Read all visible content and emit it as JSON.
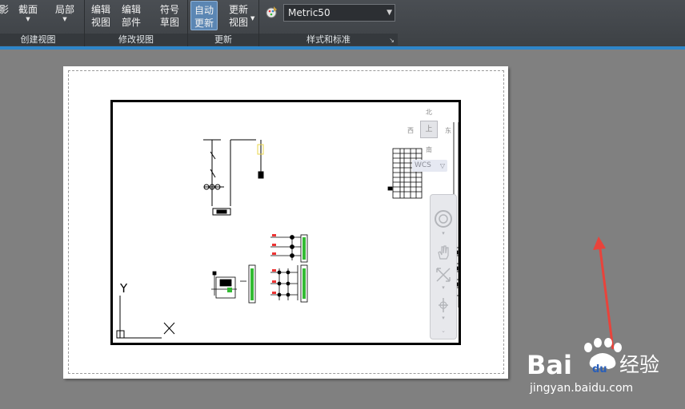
{
  "ribbon": {
    "panels": [
      {
        "title": "创建视图",
        "buttons": [
          {
            "label": "影",
            "caret": false
          },
          {
            "label": "截面",
            "caret": true
          },
          {
            "label": "局部",
            "caret": true
          }
        ]
      },
      {
        "title": "修改视图",
        "buttons": [
          {
            "label": "编辑\n视图"
          },
          {
            "label": "编辑\n部件"
          },
          {
            "label": "符号\n草图"
          }
        ]
      },
      {
        "title": "更新",
        "buttons": [
          {
            "label": "自动\n更新",
            "active": true
          },
          {
            "label": "更新\n视图",
            "caret": true
          }
        ]
      },
      {
        "title": "样式和标准",
        "combo_value": "Metric50",
        "launcher": "↘"
      }
    ]
  },
  "viewcube": {
    "north": "北",
    "south": "南",
    "east": "东",
    "west": "西",
    "face": "上",
    "wcs_label": "WCS"
  },
  "axis": {
    "x": "X",
    "y": "Y"
  },
  "watermark": {
    "brand": "Bai",
    "brand2": "du",
    "suffix": "经验",
    "url": "jingyan.baidu.com"
  },
  "colors": {
    "ribbon_bg": "#3e4246",
    "accent_blue": "#2f86c9",
    "active_btn": "#5b86b3",
    "workspace": "#808080",
    "arrow_red": "#e8433b",
    "baidu_blue": "#2a5fb8"
  }
}
